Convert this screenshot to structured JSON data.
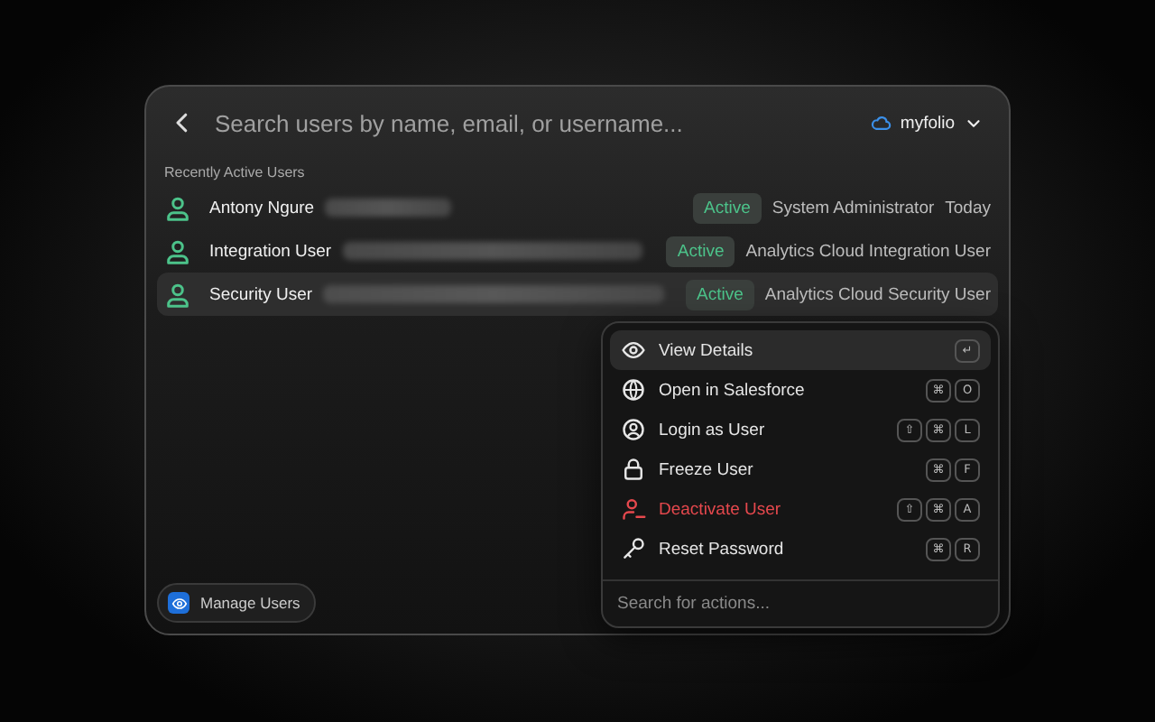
{
  "search": {
    "placeholder": "Search users by name, email, or username..."
  },
  "org": {
    "label": "myfolio"
  },
  "section_title": "Recently Active Users",
  "users": [
    {
      "name": "Antony Ngure",
      "status": "Active",
      "role": "System Administrator",
      "last_active": "Today",
      "selected": false
    },
    {
      "name": "Integration User",
      "status": "Active",
      "role": "Analytics Cloud Integration User",
      "selected": false
    },
    {
      "name": "Security User",
      "status": "Active",
      "role": "Analytics Cloud Security User",
      "selected": true
    }
  ],
  "footer_button": {
    "label": "Manage Users"
  },
  "actions_menu": {
    "items": [
      {
        "kind": "eye",
        "label": "View Details",
        "keys": [
          "↵"
        ],
        "selected": true,
        "danger": false
      },
      {
        "kind": "globe",
        "label": "Open in Salesforce",
        "keys": [
          "⌘",
          "O"
        ],
        "selected": false,
        "danger": false
      },
      {
        "kind": "user-circle",
        "label": "Login as User",
        "keys": [
          "⇧",
          "⌘",
          "L"
        ],
        "selected": false,
        "danger": false
      },
      {
        "kind": "lock",
        "label": "Freeze User",
        "keys": [
          "⌘",
          "F"
        ],
        "selected": false,
        "danger": false
      },
      {
        "kind": "user-minus",
        "label": "Deactivate User",
        "keys": [
          "⇧",
          "⌘",
          "A"
        ],
        "selected": false,
        "danger": true
      },
      {
        "kind": "key",
        "label": "Reset Password",
        "keys": [
          "⌘",
          "R"
        ],
        "selected": false,
        "danger": false
      }
    ],
    "search": {
      "placeholder": "Search for actions..."
    }
  }
}
